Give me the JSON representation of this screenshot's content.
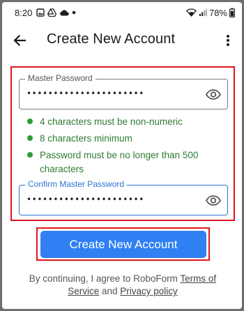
{
  "status_bar": {
    "time": "8:20",
    "battery": "78%",
    "left_icons": [
      "image-icon",
      "cloud-icon",
      "dot-icon"
    ],
    "right_icons": [
      "wifi-icon",
      "signal-icon",
      "battery-icon"
    ]
  },
  "app_bar": {
    "title": "Create New Account",
    "back_icon": "arrow-back-icon",
    "menu_icon": "more-vert-icon"
  },
  "form": {
    "master_password": {
      "label": "Master Password",
      "value": "••••••••••••••••••••••"
    },
    "requirements": [
      "4 characters must be non-numeric",
      "8 characters minimum",
      "Password must be no longer than 500 characters"
    ],
    "confirm_password": {
      "label": "Confirm Master Password",
      "value": "••••••••••••••••••••••"
    }
  },
  "actions": {
    "create_label": "Create New Account"
  },
  "terms": {
    "prefix": "By continuing, I agree to RoboForm ",
    "terms_link": "Terms of Service",
    "conjunction": " and ",
    "privacy_link": "Privacy policy"
  },
  "colors": {
    "accent": "#2f80f3",
    "requirement_ok": "#2e7d32",
    "highlight": "#e0161e"
  }
}
